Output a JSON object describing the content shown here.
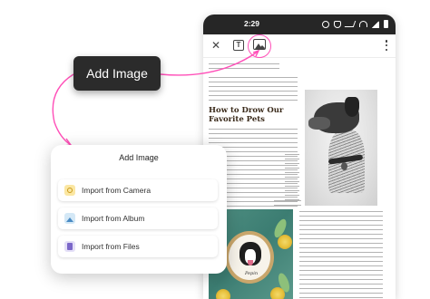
{
  "status_bar": {
    "time": "2:29"
  },
  "callout": {
    "label": "Add Image"
  },
  "article": {
    "title": "How to Drow Our Favorite Pets"
  },
  "photo": {
    "embroidery_name": "Pepin"
  },
  "sheet": {
    "title": "Add Image",
    "items": [
      {
        "label": "Import from Camera",
        "icon": "camera-icon"
      },
      {
        "label": "Import from Album",
        "icon": "album-icon"
      },
      {
        "label": "Import from Files",
        "icon": "files-icon"
      }
    ]
  },
  "colors": {
    "accent_pink": "#ff4fb8",
    "callout_bg": "#2b2b2b",
    "status_bar_bg": "#262626"
  }
}
